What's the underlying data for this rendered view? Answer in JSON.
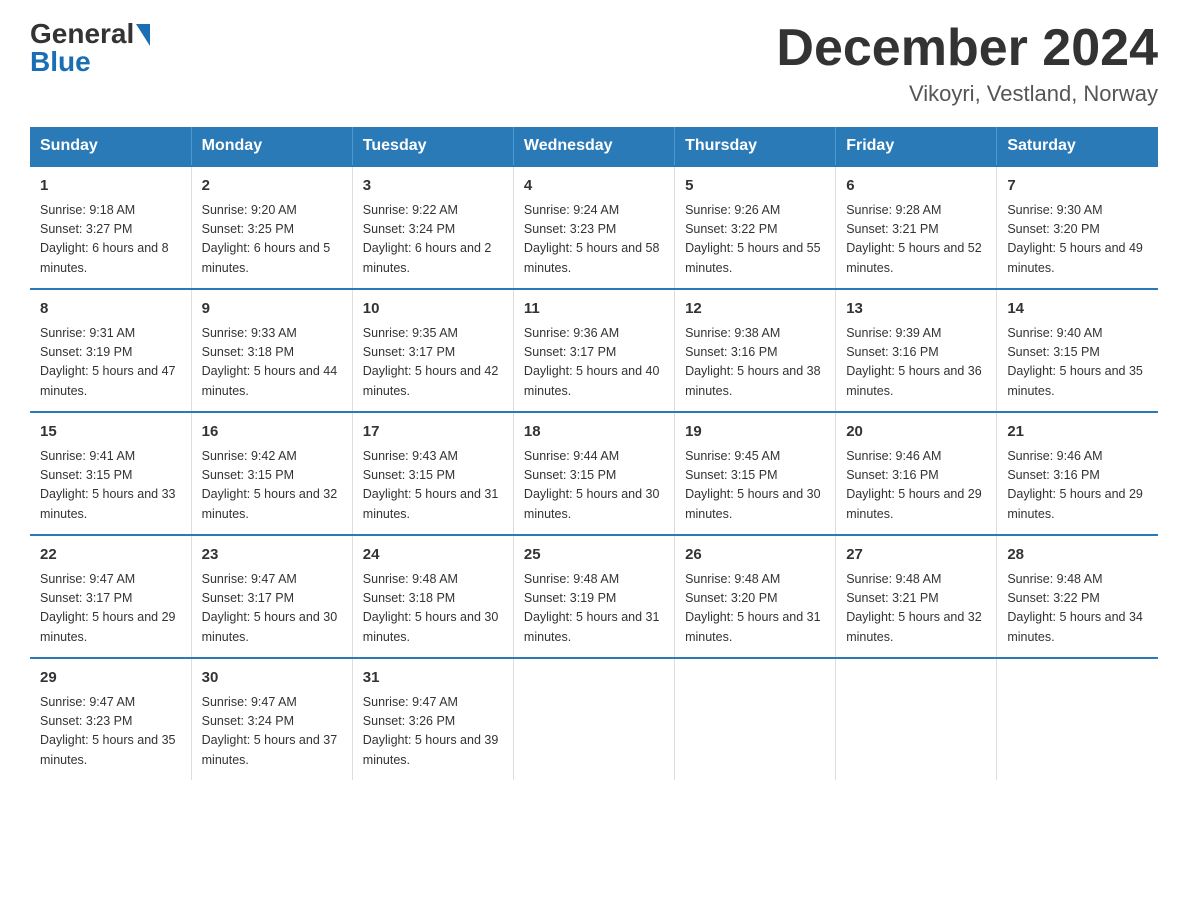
{
  "header": {
    "logo_general": "General",
    "logo_blue": "Blue",
    "month_title": "December 2024",
    "location": "Vikoyri, Vestland, Norway"
  },
  "weekdays": [
    "Sunday",
    "Monday",
    "Tuesday",
    "Wednesday",
    "Thursday",
    "Friday",
    "Saturday"
  ],
  "weeks": [
    [
      {
        "day": "1",
        "sunrise": "9:18 AM",
        "sunset": "3:27 PM",
        "daylight": "6 hours and 8 minutes."
      },
      {
        "day": "2",
        "sunrise": "9:20 AM",
        "sunset": "3:25 PM",
        "daylight": "6 hours and 5 minutes."
      },
      {
        "day": "3",
        "sunrise": "9:22 AM",
        "sunset": "3:24 PM",
        "daylight": "6 hours and 2 minutes."
      },
      {
        "day": "4",
        "sunrise": "9:24 AM",
        "sunset": "3:23 PM",
        "daylight": "5 hours and 58 minutes."
      },
      {
        "day": "5",
        "sunrise": "9:26 AM",
        "sunset": "3:22 PM",
        "daylight": "5 hours and 55 minutes."
      },
      {
        "day": "6",
        "sunrise": "9:28 AM",
        "sunset": "3:21 PM",
        "daylight": "5 hours and 52 minutes."
      },
      {
        "day": "7",
        "sunrise": "9:30 AM",
        "sunset": "3:20 PM",
        "daylight": "5 hours and 49 minutes."
      }
    ],
    [
      {
        "day": "8",
        "sunrise": "9:31 AM",
        "sunset": "3:19 PM",
        "daylight": "5 hours and 47 minutes."
      },
      {
        "day": "9",
        "sunrise": "9:33 AM",
        "sunset": "3:18 PM",
        "daylight": "5 hours and 44 minutes."
      },
      {
        "day": "10",
        "sunrise": "9:35 AM",
        "sunset": "3:17 PM",
        "daylight": "5 hours and 42 minutes."
      },
      {
        "day": "11",
        "sunrise": "9:36 AM",
        "sunset": "3:17 PM",
        "daylight": "5 hours and 40 minutes."
      },
      {
        "day": "12",
        "sunrise": "9:38 AM",
        "sunset": "3:16 PM",
        "daylight": "5 hours and 38 minutes."
      },
      {
        "day": "13",
        "sunrise": "9:39 AM",
        "sunset": "3:16 PM",
        "daylight": "5 hours and 36 minutes."
      },
      {
        "day": "14",
        "sunrise": "9:40 AM",
        "sunset": "3:15 PM",
        "daylight": "5 hours and 35 minutes."
      }
    ],
    [
      {
        "day": "15",
        "sunrise": "9:41 AM",
        "sunset": "3:15 PM",
        "daylight": "5 hours and 33 minutes."
      },
      {
        "day": "16",
        "sunrise": "9:42 AM",
        "sunset": "3:15 PM",
        "daylight": "5 hours and 32 minutes."
      },
      {
        "day": "17",
        "sunrise": "9:43 AM",
        "sunset": "3:15 PM",
        "daylight": "5 hours and 31 minutes."
      },
      {
        "day": "18",
        "sunrise": "9:44 AM",
        "sunset": "3:15 PM",
        "daylight": "5 hours and 30 minutes."
      },
      {
        "day": "19",
        "sunrise": "9:45 AM",
        "sunset": "3:15 PM",
        "daylight": "5 hours and 30 minutes."
      },
      {
        "day": "20",
        "sunrise": "9:46 AM",
        "sunset": "3:16 PM",
        "daylight": "5 hours and 29 minutes."
      },
      {
        "day": "21",
        "sunrise": "9:46 AM",
        "sunset": "3:16 PM",
        "daylight": "5 hours and 29 minutes."
      }
    ],
    [
      {
        "day": "22",
        "sunrise": "9:47 AM",
        "sunset": "3:17 PM",
        "daylight": "5 hours and 29 minutes."
      },
      {
        "day": "23",
        "sunrise": "9:47 AM",
        "sunset": "3:17 PM",
        "daylight": "5 hours and 30 minutes."
      },
      {
        "day": "24",
        "sunrise": "9:48 AM",
        "sunset": "3:18 PM",
        "daylight": "5 hours and 30 minutes."
      },
      {
        "day": "25",
        "sunrise": "9:48 AM",
        "sunset": "3:19 PM",
        "daylight": "5 hours and 31 minutes."
      },
      {
        "day": "26",
        "sunrise": "9:48 AM",
        "sunset": "3:20 PM",
        "daylight": "5 hours and 31 minutes."
      },
      {
        "day": "27",
        "sunrise": "9:48 AM",
        "sunset": "3:21 PM",
        "daylight": "5 hours and 32 minutes."
      },
      {
        "day": "28",
        "sunrise": "9:48 AM",
        "sunset": "3:22 PM",
        "daylight": "5 hours and 34 minutes."
      }
    ],
    [
      {
        "day": "29",
        "sunrise": "9:47 AM",
        "sunset": "3:23 PM",
        "daylight": "5 hours and 35 minutes."
      },
      {
        "day": "30",
        "sunrise": "9:47 AM",
        "sunset": "3:24 PM",
        "daylight": "5 hours and 37 minutes."
      },
      {
        "day": "31",
        "sunrise": "9:47 AM",
        "sunset": "3:26 PM",
        "daylight": "5 hours and 39 minutes."
      },
      {
        "day": "",
        "sunrise": "",
        "sunset": "",
        "daylight": ""
      },
      {
        "day": "",
        "sunrise": "",
        "sunset": "",
        "daylight": ""
      },
      {
        "day": "",
        "sunrise": "",
        "sunset": "",
        "daylight": ""
      },
      {
        "day": "",
        "sunrise": "",
        "sunset": "",
        "daylight": ""
      }
    ]
  ]
}
